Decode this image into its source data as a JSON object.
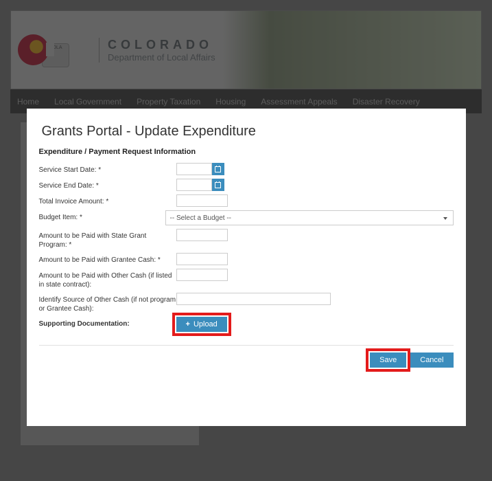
{
  "header": {
    "title_main": "COLORADO",
    "subtitle": "Department of Local Affairs",
    "logo_label": "DOLA"
  },
  "nav": {
    "items": [
      "Home",
      "Local Government",
      "Property Taxation",
      "Housing",
      "Assessment Appeals",
      "Disaster Recovery"
    ]
  },
  "modal": {
    "title": "Grants Portal - Update Expenditure",
    "section_title": "Expenditure / Payment Request Information",
    "labels": {
      "service_start": "Service Start Date: *",
      "service_end": "Service End Date: *",
      "total_invoice": "Total Invoice Amount: *",
      "budget_item": "Budget Item: *",
      "amount_state": "Amount to be Paid with State Grant Program: *",
      "amount_grantee": "Amount to be Paid with Grantee Cash: *",
      "amount_other": "Amount to be Paid with Other Cash (if listed in state contract):",
      "identify_source": "Identify Source of Other Cash (if not program or Grantee Cash):",
      "supporting_doc": "Supporting Documentation:"
    },
    "budget_placeholder": "-- Select a Budget --",
    "upload_label": "Upload",
    "save_label": "Save",
    "cancel_label": "Cancel"
  }
}
